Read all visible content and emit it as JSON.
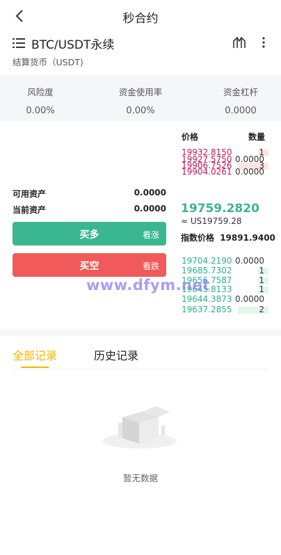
{
  "header": {
    "title": "秒合约"
  },
  "pair": {
    "name": "BTC/USDT永续",
    "settlement": "结算货币（USDT)"
  },
  "stats": [
    {
      "label": "风险度",
      "value": "0.00%"
    },
    {
      "label": "资金使用率",
      "value": "0.00%"
    },
    {
      "label": "资金杠杆",
      "value": "0.0000"
    }
  ],
  "orderbook": {
    "price_header": "价格",
    "qty_header": "数量",
    "asks": [
      {
        "price": "19932.8150",
        "qty": "1",
        "depth": 0.35
      },
      {
        "price": "19927.5750",
        "qty": "0.0000",
        "depth": 0
      },
      {
        "price": "19906.7526",
        "qty": "3",
        "depth": 1.0
      },
      {
        "price": "19904.0261",
        "qty": "0.0000",
        "depth": 0
      }
    ],
    "bids": [
      {
        "price": "19704.2190",
        "qty": "0.0000",
        "depth": 0
      },
      {
        "price": "19685.7302",
        "qty": "1",
        "depth": 0.35
      },
      {
        "price": "19656.7587",
        "qty": "1",
        "depth": 0.35
      },
      {
        "price": "19645.8133",
        "qty": "1",
        "depth": 0.35
      },
      {
        "price": "19644.3873",
        "qty": "0.0000",
        "depth": 0
      },
      {
        "price": "19637.2855",
        "qty": "2",
        "depth": 1.0
      }
    ],
    "last_price": "19759.2820",
    "usd_price": "≈ US19759.28",
    "index_label": "指数价格",
    "index_value": "19891.9400"
  },
  "assets": {
    "available_label": "可用资产",
    "available_value": "0.0000",
    "current_label": "当前资产",
    "current_value": "0.0000"
  },
  "buttons": {
    "buy_label": "买多",
    "buy_sub": "看涨",
    "sell_label": "买空",
    "sell_sub": "看跌"
  },
  "watermark": "www.dfym.net",
  "tabs": {
    "all": "全部记录",
    "history": "历史记录"
  },
  "empty": {
    "text": "暂无数据"
  },
  "colors": {
    "accent": "#f2b600",
    "buy": "#3bb78f",
    "sell": "#f05a5a",
    "ask_price": "#c2185b",
    "bid_price": "#2eaf89"
  }
}
